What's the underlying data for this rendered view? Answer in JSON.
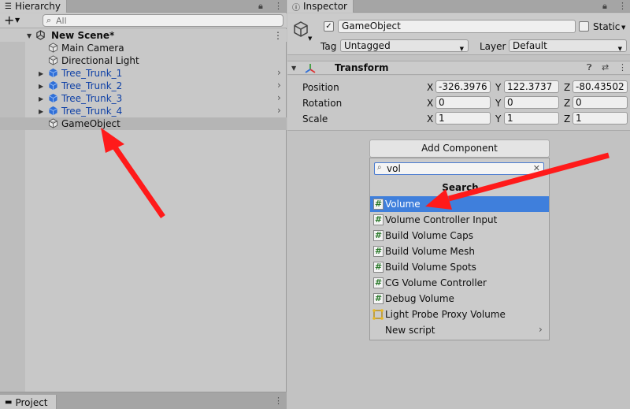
{
  "hierarchy": {
    "tab_title": "Hierarchy",
    "search_placeholder": "All",
    "scene_name": "New Scene*",
    "items": [
      {
        "label": "Main Camera",
        "prefab": false
      },
      {
        "label": "Directional Light",
        "prefab": false
      },
      {
        "label": "Tree_Trunk_1",
        "prefab": true
      },
      {
        "label": "Tree_Trunk_2",
        "prefab": true
      },
      {
        "label": "Tree_Trunk_3",
        "prefab": true
      },
      {
        "label": "Tree_Trunk_4",
        "prefab": true
      },
      {
        "label": "GameObject",
        "prefab": false
      }
    ],
    "icons": {
      "add": "plus-icon",
      "lock": "lock-icon",
      "menu": "kebab-menu-icon",
      "search": "search-icon"
    }
  },
  "project": {
    "tab_title": "Project"
  },
  "inspector": {
    "tab_title": "Inspector",
    "object_name": "GameObject",
    "active_checked": true,
    "static_label": "Static",
    "tag_label": "Tag",
    "tag_value": "Untagged",
    "layer_label": "Layer",
    "layer_value": "Default",
    "transform": {
      "title": "Transform",
      "rows": [
        {
          "name": "Position",
          "x": "-326.3976",
          "y": "122.3737",
          "z": "-80.43502"
        },
        {
          "name": "Rotation",
          "x": "0",
          "y": "0",
          "z": "0"
        },
        {
          "name": "Scale",
          "x": "1",
          "y": "1",
          "z": "1"
        }
      ],
      "axis_labels": [
        "X",
        "Y",
        "Z"
      ]
    },
    "add_component": {
      "button_label": "Add Component",
      "search_value": "vol",
      "section_title": "Search",
      "results": [
        {
          "label": "Volume",
          "icon": "script-hash-icon",
          "selected": true
        },
        {
          "label": "Volume Controller Input",
          "icon": "script-hash-icon",
          "selected": false
        },
        {
          "label": "Build Volume Caps",
          "icon": "script-hash-icon",
          "selected": false
        },
        {
          "label": "Build Volume Mesh",
          "icon": "script-hash-icon",
          "selected": false
        },
        {
          "label": "Build Volume Spots",
          "icon": "script-hash-icon",
          "selected": false
        },
        {
          "label": "CG Volume Controller",
          "icon": "script-hash-icon",
          "selected": false
        },
        {
          "label": "Debug Volume",
          "icon": "script-hash-icon",
          "selected": false
        },
        {
          "label": "Light Probe Proxy Volume",
          "icon": "light-probe-icon",
          "selected": false
        },
        {
          "label": "New script",
          "icon": "",
          "selected": false
        }
      ]
    }
  },
  "colors": {
    "selection_blue": "#3f7fdc",
    "prefab_blue": "#0d3fa6",
    "annotation_red": "#ff0000"
  }
}
